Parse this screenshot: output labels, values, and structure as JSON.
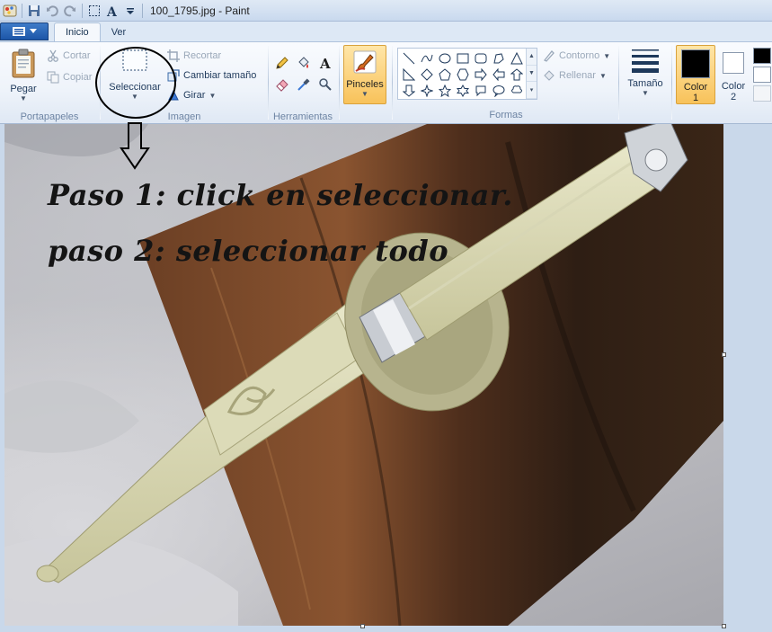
{
  "window": {
    "title": "100_1795.jpg - Paint"
  },
  "tabs": [
    {
      "label": "Inicio",
      "active": true
    },
    {
      "label": "Ver",
      "active": false
    }
  ],
  "clipboard": {
    "paste_label": "Pegar",
    "cut_label": "Cortar",
    "copy_label": "Copiar",
    "group_label": "Portapapeles"
  },
  "image": {
    "select_label": "Seleccionar",
    "crop_label": "Recortar",
    "resize_label": "Cambiar tamaño",
    "rotate_label": "Girar",
    "group_label": "Imagen"
  },
  "tools": {
    "group_label": "Herramientas",
    "items": [
      "pencil-icon",
      "fill-icon",
      "text-icon",
      "eraser-icon",
      "color-picker-icon",
      "magnifier-icon"
    ]
  },
  "brushes": {
    "label": "Pinceles"
  },
  "shapes": {
    "group_label": "Formas",
    "outline_label": "Contorno",
    "fill_label": "Rellenar"
  },
  "size": {
    "label": "Tamaño"
  },
  "colors": {
    "color1_label": "Color",
    "color1_num": "1",
    "color2_label": "Color",
    "color2_num": "2",
    "color1_value": "#000000",
    "color2_value": "#ffffff"
  },
  "annotation": {
    "line1": "Paso 1: click en seleccionar.",
    "line2": "paso 2: seleccionar todo"
  },
  "theme": {
    "accent": "#1c56a8",
    "highlight": "#f8c25a"
  }
}
